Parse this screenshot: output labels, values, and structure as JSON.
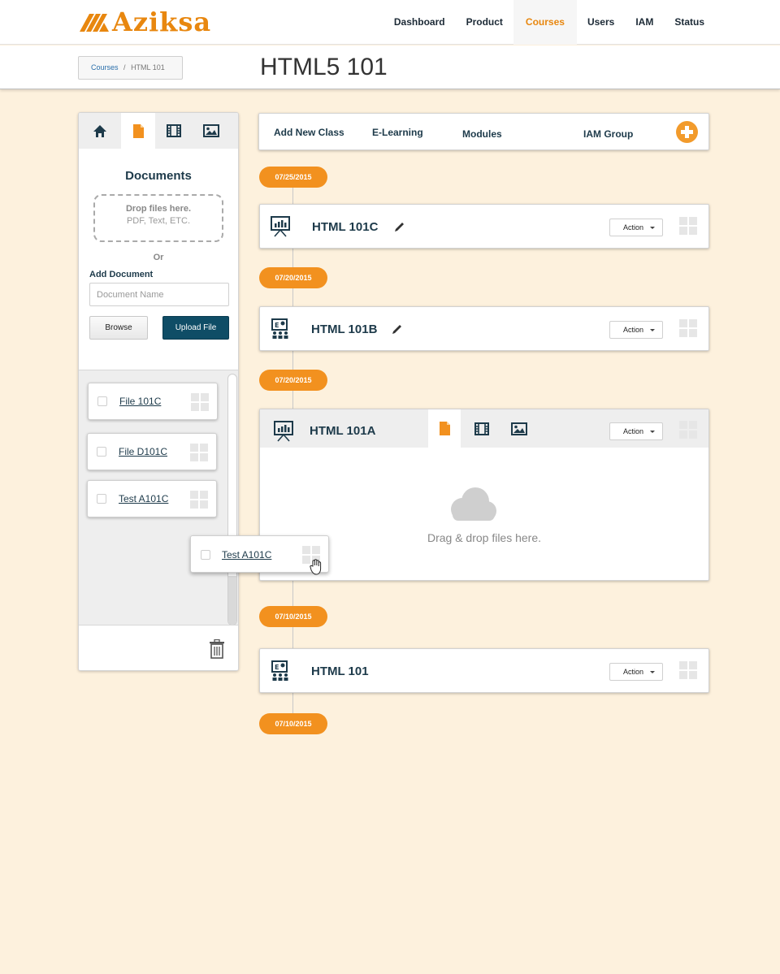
{
  "brand": {
    "name": "Aziksa",
    "color": "#e8870f"
  },
  "nav": {
    "items": [
      {
        "label": "Dashboard",
        "active": false
      },
      {
        "label": "Product",
        "active": false
      },
      {
        "label": "Courses",
        "active": true
      },
      {
        "label": "Users",
        "active": false
      },
      {
        "label": "IAM",
        "active": false
      },
      {
        "label": "Status",
        "active": false
      }
    ]
  },
  "breadcrumb": {
    "parent": "Courses",
    "separator": "/",
    "current": "HTML 101"
  },
  "page_title": "HTML5 101",
  "left_panel": {
    "tabs": [
      "home-icon",
      "document-icon",
      "film-icon",
      "image-icon"
    ],
    "active_tab": "document-icon",
    "heading": "Documents",
    "dropzone": {
      "line1": "Drop files here.",
      "line2": "PDF, Text, ETC."
    },
    "or_text": "Or",
    "add_label": "Add Document",
    "input_placeholder": "Document Name",
    "browse_label": "Browse",
    "upload_label": "Upload File",
    "files": [
      {
        "name": "File 101C"
      },
      {
        "name": "File D101C"
      },
      {
        "name": "Test A101C"
      }
    ],
    "dragging_file": {
      "name": "Test A101C"
    }
  },
  "toolbar": {
    "add_class": "Add New Class",
    "elearning": "E-Learning",
    "modules": "Modules",
    "iam_group": "IAM Group"
  },
  "timeline": {
    "dates": [
      "07/25/2015",
      "07/20/2015",
      "07/20/2015",
      "07/10/2015",
      "07/10/2015"
    ],
    "classes": [
      {
        "title": "HTML 101C",
        "icon": "presentation-icon",
        "action": "Action"
      },
      {
        "title": "HTML 101B",
        "icon": "elearning-icon",
        "action": "Action"
      },
      {
        "title": "HTML 101A",
        "icon": "presentation-icon",
        "action": "Action",
        "drop_text": "Drag & drop files here."
      },
      {
        "title": "HTML 101",
        "icon": "elearning-icon",
        "action": "Action"
      }
    ]
  },
  "colors": {
    "accent": "#f2911f",
    "navy": "#0f4d66",
    "page_bg": "#fdf1dd"
  }
}
